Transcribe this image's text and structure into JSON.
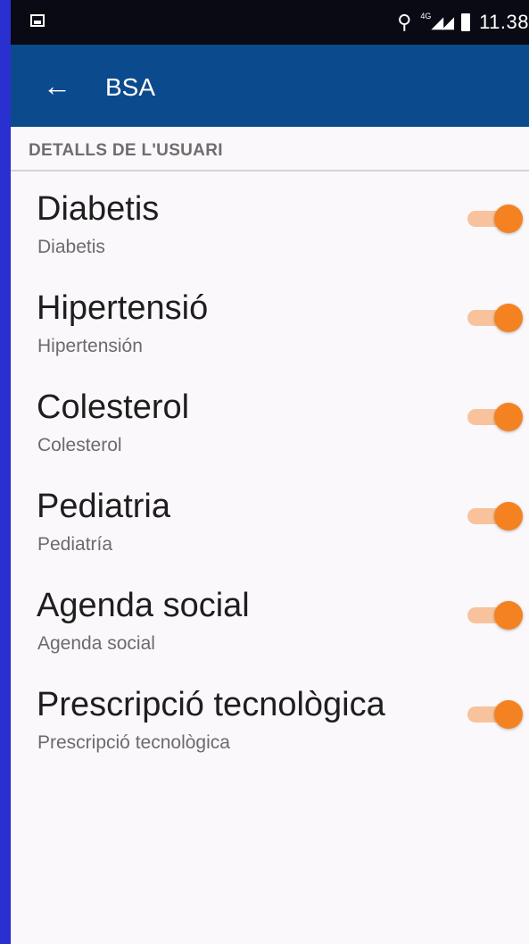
{
  "status_bar": {
    "image_icon": "image-icon",
    "location_icon": "location-pin-icon",
    "network_label": "4G",
    "signal_icon": "signal-icon",
    "battery_icon": "battery-icon",
    "time": "11.38"
  },
  "app_bar": {
    "back_icon": "arrow-left-icon",
    "title": "BSA"
  },
  "section": {
    "title": "DETALLS DE L'USUARI"
  },
  "accent_color": "#f58220",
  "toolbar_color": "#0b4a8c",
  "preferences": [
    {
      "title": "Diabetis",
      "subtitle": "Diabetis",
      "enabled": true
    },
    {
      "title": "Hipertensió",
      "subtitle": "Hipertensión",
      "enabled": true
    },
    {
      "title": "Colesterol",
      "subtitle": "Colesterol",
      "enabled": true
    },
    {
      "title": "Pediatria",
      "subtitle": "Pediatría",
      "enabled": true
    },
    {
      "title": "Agenda social",
      "subtitle": "Agenda social",
      "enabled": true
    },
    {
      "title": "Prescripció tecnològica",
      "subtitle": "Prescripció tecnològica",
      "enabled": true
    }
  ]
}
